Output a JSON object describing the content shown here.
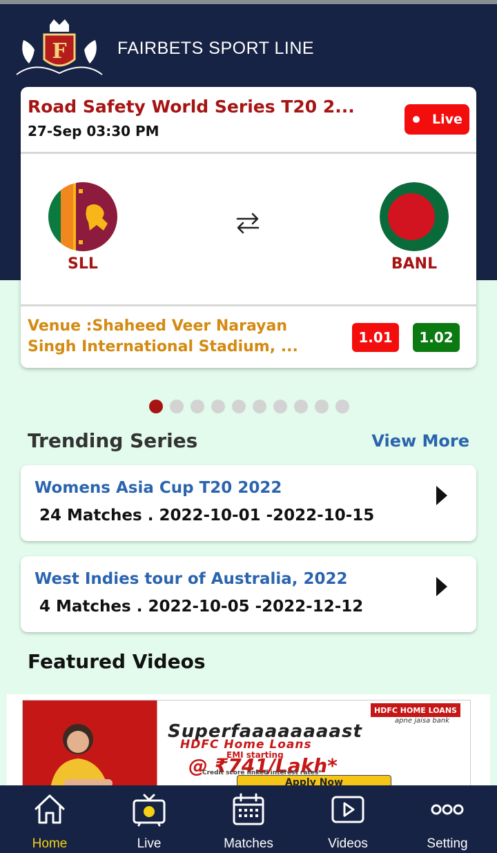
{
  "app": {
    "title": "FAIRBETS SPORT LINE",
    "logo_letter": "F"
  },
  "match": {
    "title": "Road Safety World Series T20 2...",
    "datetime": "27-Sep 03:30 PM",
    "live_label": "Live",
    "team_left": "SLL",
    "team_right": "BANL",
    "venue": "Venue :Shaheed Veer Narayan Singh International Stadium, ...",
    "odds": [
      "1.01",
      "1.02"
    ]
  },
  "carousel": {
    "total": 10,
    "active": 0
  },
  "trending": {
    "title": "Trending Series",
    "view_more": "View More",
    "series": [
      {
        "name": "Womens Asia Cup T20 2022",
        "info": "24 Matches . 2022-10-01 -2022-10-15"
      },
      {
        "name": "West Indies tour of Australia, 2022",
        "info": "4 Matches . 2022-10-05 -2022-12-12"
      }
    ]
  },
  "featured": {
    "title": "Featured Videos"
  },
  "ad": {
    "brand": "HDFC HOME LOANS",
    "tagline": "apne jaisa bank",
    "headline": "Superfaaaaaaaast",
    "sub": "HDFC Home Loans",
    "emi": "EMI starting",
    "price": "@ ₹741/Lakh*",
    "credit": "Credit score linked interest rates*",
    "apply": "Apply Now"
  },
  "nav": [
    {
      "label": "Home",
      "icon": "home-icon",
      "active": true
    },
    {
      "label": "Live",
      "icon": "tv-icon",
      "active": false
    },
    {
      "label": "Matches",
      "icon": "calendar-icon",
      "active": false
    },
    {
      "label": "Videos",
      "icon": "video-play-icon",
      "active": false
    },
    {
      "label": "Setting",
      "icon": "more-dots-icon",
      "active": false
    }
  ],
  "colors": {
    "header": "#172344",
    "accent_red": "#a61413",
    "live_red": "#f30d0d",
    "odds_green": "#0b7a11",
    "link_blue": "#2b64ae",
    "venue_orange": "#d48a12",
    "nav_active": "#f4d112",
    "background": "#e2fbec"
  }
}
